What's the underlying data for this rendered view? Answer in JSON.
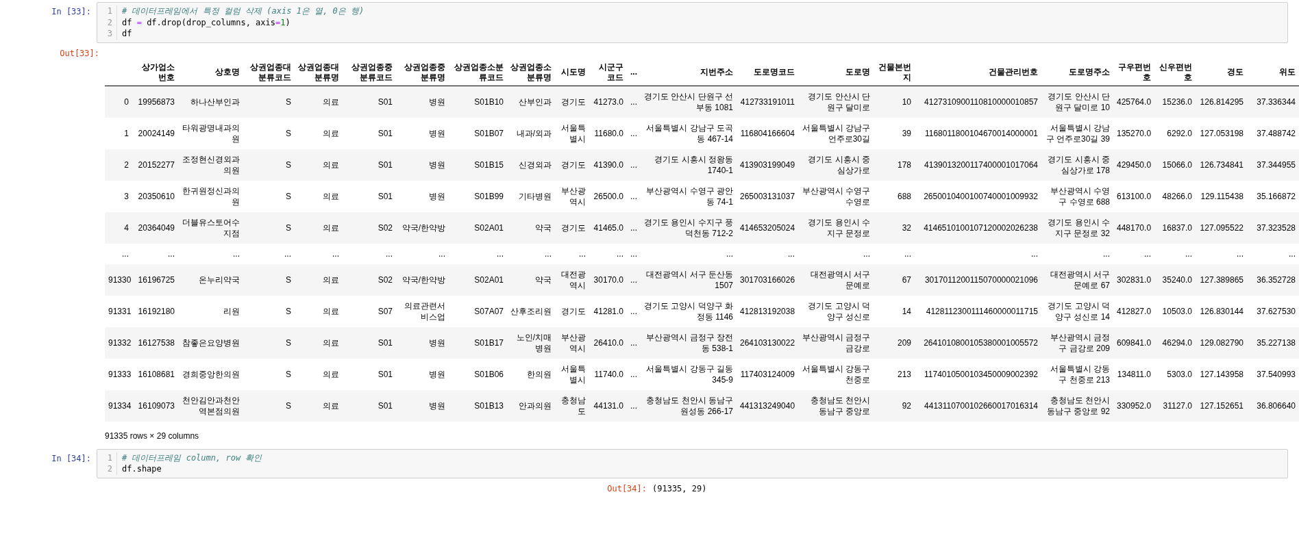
{
  "cells": [
    {
      "kind": "code",
      "prompt": "In [33]:",
      "lines": [
        {
          "number": "1",
          "tokens": [
            {
              "text": "# 데이터프레임에서 특정 컬럼 삭제 (axis 1은 열, 0은 행)",
              "kind": "comment"
            }
          ]
        },
        {
          "number": "2",
          "tokens": [
            {
              "text": "df ",
              "kind": "plain"
            },
            {
              "text": "=",
              "kind": "operator"
            },
            {
              "text": " df.drop(drop_columns, axis",
              "kind": "plain"
            },
            {
              "text": "=",
              "kind": "operator"
            },
            {
              "text": "1",
              "kind": "number"
            },
            {
              "text": ")",
              "kind": "plain"
            }
          ]
        },
        {
          "number": "3",
          "tokens": [
            {
              "text": "df",
              "kind": "plain"
            }
          ]
        }
      ]
    },
    {
      "kind": "dataframe",
      "prompt": "Out[33]:",
      "columns": [
        "",
        "상가업소번호",
        "상호명",
        "상권업종대분류코드",
        "상권업종대분류명",
        "상권업종중분류코드",
        "상권업종중분류명",
        "상권업종소분류코드",
        "상권업종소분류명",
        "시도명",
        "시군구코드",
        "...",
        "지번주소",
        "도로명코드",
        "도로명",
        "건물본번지",
        "건물관리번호",
        "도로명주소",
        "구우편번호",
        "신우편번호",
        "경도",
        "위도"
      ],
      "rows": [
        [
          "0",
          "19956873",
          "하나산부인과",
          "S",
          "의료",
          "S01",
          "병원",
          "S01B10",
          "산부인과",
          "경기도",
          "41273.0",
          "...",
          "경기도 안산시 단원구 선부동 1081",
          "412733191011",
          "경기도 안산시 단원구 달미로",
          "10",
          "4127310900110810000010857",
          "경기도 안산시 단원구 달미로 10",
          "425764.0",
          "15236.0",
          "126.814295",
          "37.336344"
        ],
        [
          "1",
          "20024149",
          "타워광명내과의원",
          "S",
          "의료",
          "S01",
          "병원",
          "S01B07",
          "내과/외과",
          "서울특별시",
          "11680.0",
          "...",
          "서울특별시 강남구 도곡동 467-14",
          "116804166604",
          "서울특별시 강남구 언주로30길",
          "39",
          "1168011800104670014000001",
          "서울특별시 강남구 언주로30길 39",
          "135270.0",
          "6292.0",
          "127.053198",
          "37.488742"
        ],
        [
          "2",
          "20152277",
          "조정현신경외과의원",
          "S",
          "의료",
          "S01",
          "병원",
          "S01B15",
          "신경외과",
          "경기도",
          "41390.0",
          "...",
          "경기도 시흥시 정왕동 1740-1",
          "413903199049",
          "경기도 시흥시 중심상가로",
          "178",
          "4139013200117400001017064",
          "경기도 시흥시 중심상가로 178",
          "429450.0",
          "15066.0",
          "126.734841",
          "37.344955"
        ],
        [
          "3",
          "20350610",
          "한귀원정신과의원",
          "S",
          "의료",
          "S01",
          "병원",
          "S01B99",
          "기타병원",
          "부산광역시",
          "26500.0",
          "...",
          "부산광역시 수영구 광안동 74-1",
          "265003131037",
          "부산광역시 수영구 수영로",
          "688",
          "2650010400100740001009932",
          "부산광역시 수영구 수영로 688",
          "613100.0",
          "48266.0",
          "129.115438",
          "35.166872"
        ],
        [
          "4",
          "20364049",
          "더블유스토어수지점",
          "S",
          "의료",
          "S02",
          "약국/한약방",
          "S02A01",
          "약국",
          "경기도",
          "41465.0",
          "...",
          "경기도 용인시 수지구 풍덕천동 712-2",
          "414653205024",
          "경기도 용인시 수지구 문정로",
          "32",
          "4146510100107120002026238",
          "경기도 용인시 수지구 문정로 32",
          "448170.0",
          "16837.0",
          "127.095522",
          "37.323528"
        ],
        [
          "...",
          "...",
          "...",
          "...",
          "...",
          "...",
          "...",
          "...",
          "...",
          "...",
          "...",
          "...",
          "...",
          "...",
          "...",
          "...",
          "...",
          "...",
          "...",
          "...",
          "...",
          "..."
        ],
        [
          "91330",
          "16196725",
          "온누리약국",
          "S",
          "의료",
          "S02",
          "약국/한약방",
          "S02A01",
          "약국",
          "대전광역시",
          "30170.0",
          "...",
          "대전광역시 서구 둔산동 1507",
          "301703166026",
          "대전광역시 서구 문예로",
          "67",
          "3017011200115070000021096",
          "대전광역시 서구 문예로 67",
          "302831.0",
          "35240.0",
          "127.389865",
          "36.352728"
        ],
        [
          "91331",
          "16192180",
          "리원",
          "S",
          "의료",
          "S07",
          "의료관련서비스업",
          "S07A07",
          "산후조리원",
          "경기도",
          "41281.0",
          "...",
          "경기도 고양시 덕양구 화정동 1146",
          "412813192038",
          "경기도 고양시 덕양구 성신로",
          "14",
          "4128112300111460000011715",
          "경기도 고양시 덕양구 성신로 14",
          "412827.0",
          "10503.0",
          "126.830144",
          "37.627530"
        ],
        [
          "91332",
          "16127538",
          "참좋은요양병원",
          "S",
          "의료",
          "S01",
          "병원",
          "S01B17",
          "노인/치매병원",
          "부산광역시",
          "26410.0",
          "...",
          "부산광역시 금정구 장전동 538-1",
          "264103130022",
          "부산광역시 금정구 금강로",
          "209",
          "2641010800105380001005572",
          "부산광역시 금정구 금강로 209",
          "609841.0",
          "46294.0",
          "129.082790",
          "35.227138"
        ],
        [
          "91333",
          "16108681",
          "경희중앙한의원",
          "S",
          "의료",
          "S01",
          "병원",
          "S01B06",
          "한의원",
          "서울특별시",
          "11740.0",
          "...",
          "서울특별시 강동구 길동 345-9",
          "117403124009",
          "서울특별시 강동구 천중로",
          "213",
          "1174010500103450009002392",
          "서울특별시 강동구 천중로 213",
          "134811.0",
          "5303.0",
          "127.143958",
          "37.540993"
        ],
        [
          "91334",
          "16109073",
          "천안김안과천안역본점의원",
          "S",
          "의료",
          "S01",
          "병원",
          "S01B13",
          "안과의원",
          "충청남도",
          "44131.0",
          "...",
          "충청남도 천안시 동남구 원성동 266-17",
          "441313249040",
          "충청남도 천안시 동남구 중앙로",
          "92",
          "4413110700102660017016314",
          "충청남도 천안시 동남구 중앙로 92",
          "330952.0",
          "31127.0",
          "127.152651",
          "36.806640"
        ]
      ],
      "summary": "91335 rows × 29 columns"
    },
    {
      "kind": "code",
      "prompt": "In [34]:",
      "lines": [
        {
          "number": "1",
          "tokens": [
            {
              "text": "# 데이터프레임 column, row 확인",
              "kind": "comment"
            }
          ]
        },
        {
          "number": "2",
          "tokens": [
            {
              "text": "df.shape",
              "kind": "plain"
            }
          ]
        }
      ]
    },
    {
      "kind": "text",
      "prompt": "Out[34]:",
      "text": "(91335, 29)"
    }
  ]
}
